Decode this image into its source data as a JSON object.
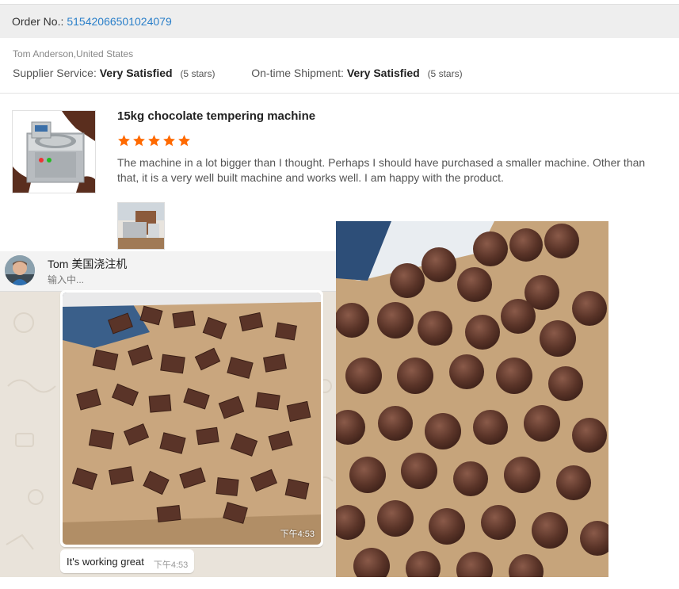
{
  "order": {
    "label": "Order No.:",
    "number": "51542066501024079"
  },
  "buyer": {
    "name_location": "Tom Anderson,United States"
  },
  "ratings": {
    "supplier_label": "Supplier Service:",
    "supplier_value": "Very Satisfied",
    "supplier_stars": "(5 stars)",
    "shipment_label": "On-time Shipment:",
    "shipment_value": "Very Satisfied",
    "shipment_stars": "(5 stars)"
  },
  "product": {
    "title": "15kg chocolate tempering machine",
    "rating": 5,
    "review": "The machine in a lot bigger than I thought. Perhaps I should have purchased a smaller machine. Other than that, it is a very well built machine and works well.  I am happy with the product."
  },
  "chat": {
    "contact_name": "Tom 美国浇注机",
    "status": "输入中...",
    "image_time": "下午4:53",
    "message_text": "It's working great",
    "message_time": "下午4:53"
  },
  "colors": {
    "star": "#ff6a00",
    "link": "#2a7fc9",
    "chocolate": "#5a3428",
    "paper": "#c9a67e"
  }
}
